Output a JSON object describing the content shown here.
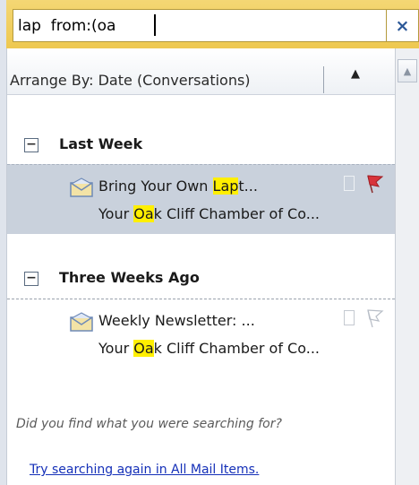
{
  "search": {
    "query": "lap  from:(oa",
    "close_glyph": "×"
  },
  "arrange": {
    "label": "Arrange By: Date (Conversations)",
    "sort_glyph": "▲"
  },
  "scrollbar": {
    "up_glyph": "▲"
  },
  "groups": [
    {
      "label": "Last Week",
      "toggle_glyph": "−",
      "items": [
        {
          "subject_pre": "Bring Your Own ",
          "subject_hl": "Lap",
          "subject_post": "t...",
          "sender_pre": "Your ",
          "sender_hl": "Oa",
          "sender_post": "k Cliff Chamber of Co...",
          "selected": true,
          "flag": "red"
        }
      ]
    },
    {
      "label": "Three Weeks Ago",
      "toggle_glyph": "−",
      "items": [
        {
          "subject_pre": "Weekly Newsletter:  ...",
          "subject_hl": "",
          "subject_post": "",
          "sender_pre": "Your ",
          "sender_hl": "Oa",
          "sender_post": "k Cliff Chamber of Co...",
          "selected": false,
          "flag": "outline"
        }
      ]
    }
  ],
  "footer": {
    "question": "Did you find what you were searching for?",
    "link": "Try searching again in All Mail Items."
  },
  "colors": {
    "search_bar": "#eec850",
    "selected_row": "#c9d1dc",
    "highlight": "#ffef00",
    "link": "#1530b8",
    "flag_red": "#d8343a"
  },
  "icons": [
    "close-icon",
    "sort-arrow-icon",
    "scroll-up-icon",
    "collapse-icon",
    "envelope-icon",
    "category-box-icon",
    "flag-icon"
  ]
}
